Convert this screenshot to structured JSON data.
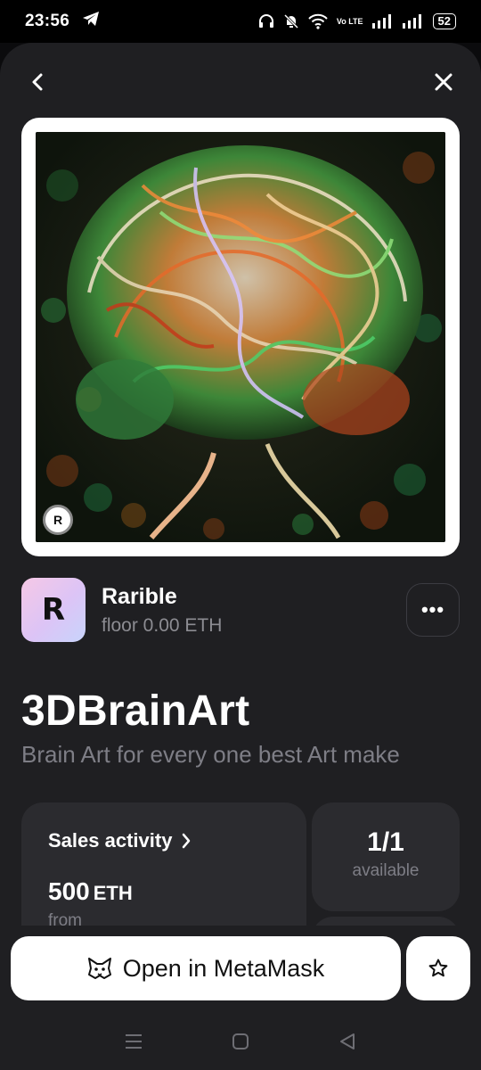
{
  "status_bar": {
    "time": "23:56",
    "battery": "52",
    "volte": "Vo LTE"
  },
  "nav": {
    "back_icon": "chevron-left-icon",
    "close_icon": "close-icon"
  },
  "nft": {
    "image_subject": "brain-artwork",
    "badge_letter": "R",
    "title": "3DBrainArt",
    "description": "Brain Art for every one best Art make"
  },
  "collection": {
    "logo_letter": "R",
    "name": "Rarible",
    "floor": "floor 0.00 ETH",
    "more_label": "•••"
  },
  "stats": {
    "sales_title": "Sales activity",
    "sales_price": "500",
    "sales_unit": "ETH",
    "sales_from": "from",
    "available_count": "1/1",
    "available_label": "available"
  },
  "actions": {
    "open_label": "Open in MetaMask",
    "favorite_icon": "star-icon"
  },
  "colors": {
    "sheet_bg": "#1f1f22",
    "card_bg": "#2b2b2f",
    "muted_text": "#7e7e86"
  }
}
